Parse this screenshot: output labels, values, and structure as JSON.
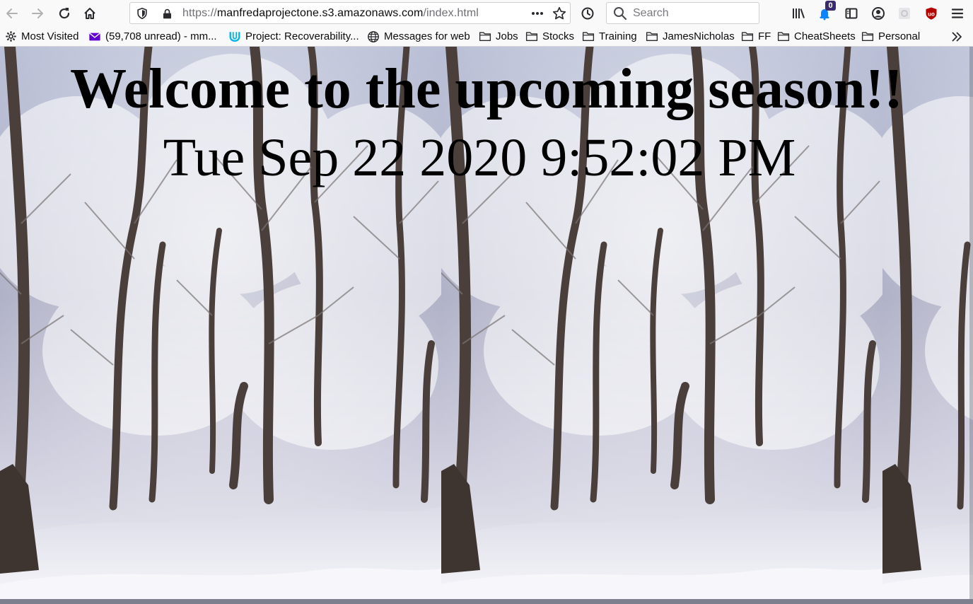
{
  "browser": {
    "url_prefix": "https://",
    "url_host": "manfredaprojectone.s3.amazonaws.com",
    "url_path": "/index.html",
    "search_placeholder": "Search",
    "notification_badge": "0",
    "icons": {
      "back": "arrow-left-icon",
      "forward": "arrow-right-icon",
      "reload": "reload-icon",
      "home": "home-icon",
      "shield": "tracking-protection-shield-icon",
      "lock": "lock-icon",
      "page_actions": "ellipsis-icon",
      "bookmark_star": "star-icon",
      "history": "clock-icon",
      "search": "search-icon",
      "library": "library-icon",
      "extension_bell": "notification-extension-icon",
      "sidebar": "sidebar-icon",
      "account": "account-icon",
      "extension_gear": "extension-gear-icon",
      "ublock": "ublock-origin-icon",
      "menu": "hamburger-menu-icon"
    }
  },
  "bookmarks": [
    {
      "label": "Most Visited",
      "icon": "gear-icon"
    },
    {
      "label": "(59,708 unread) - mm...",
      "icon": "mail-icon"
    },
    {
      "label": "Project: Recoverability...",
      "icon": "udacity-icon"
    },
    {
      "label": "Messages for web",
      "icon": "globe-icon"
    },
    {
      "label": "Jobs",
      "icon": "folder-icon"
    },
    {
      "label": "Stocks",
      "icon": "folder-icon"
    },
    {
      "label": "Training",
      "icon": "folder-icon"
    },
    {
      "label": "JamesNicholas",
      "icon": "folder-icon"
    },
    {
      "label": "FF",
      "icon": "folder-icon"
    },
    {
      "label": "CheatSheets",
      "icon": "folder-icon"
    },
    {
      "label": "Personal",
      "icon": "folder-icon"
    }
  ],
  "page": {
    "heading": "Welcome to the upcoming season!!",
    "datetime": "Tue Sep 22 2020 9:52:02 PM"
  },
  "colors": {
    "chrome_bg": "#f9f9fa",
    "heading_text": "#000000",
    "ublock_red": "#b40000",
    "badge_blue": "#0a84ff"
  }
}
